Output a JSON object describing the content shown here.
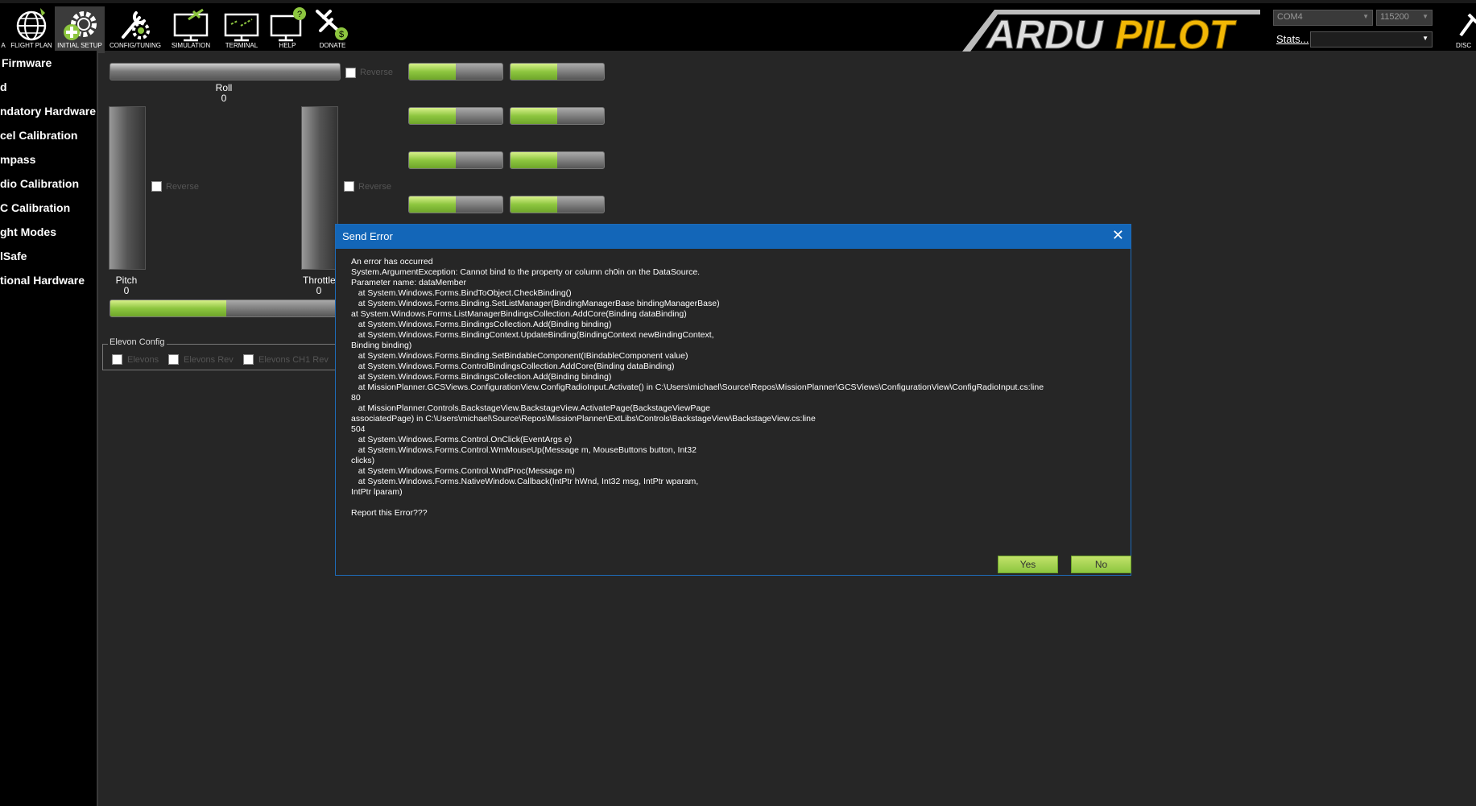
{
  "toolbar": {
    "items": [
      {
        "label": "A",
        "icon": "data-icon"
      },
      {
        "label": "FLIGHT PLAN",
        "icon": "globe-icon"
      },
      {
        "label": "INITIAL SETUP",
        "icon": "gear-plus-icon"
      },
      {
        "label": "CONFIG/TUNING",
        "icon": "wrench-gear-icon"
      },
      {
        "label": "SIMULATION",
        "icon": "monitor-plane-icon"
      },
      {
        "label": "TERMINAL",
        "icon": "terminal-monitor-icon"
      },
      {
        "label": "HELP",
        "icon": "help-monitor-icon"
      },
      {
        "label": "DONATE",
        "icon": "plane-dollar-icon"
      }
    ],
    "logo_text": "ARDUPILOT",
    "port": "COM4",
    "baud": "115200",
    "stats_label": "Stats...",
    "connect_label": "DISC"
  },
  "sidebar": {
    "items": [
      "Firmware",
      "d",
      "ndatory Hardware",
      "cel Calibration",
      "mpass",
      "dio Calibration",
      "C Calibration",
      "ght Modes",
      "lSafe",
      "tional Hardware"
    ]
  },
  "radio": {
    "roll_label": "Roll",
    "roll_value": "0",
    "pitch_label": "Pitch",
    "pitch_value": "0",
    "throttle_label": "Throttle",
    "throttle_value": "0",
    "reverse_label": "Reverse",
    "channel_fill": 0.5,
    "bottom_bar_fill": 0.5,
    "elevon_config_title": "Elevon Config",
    "elevons_label": "Elevons",
    "elevons_rev_label": "Elevons Rev",
    "elevons_ch1_rev_label": "Elevons CH1 Rev"
  },
  "dialog": {
    "title": "Send Error",
    "message": "An error has occurred\nSystem.ArgumentException: Cannot bind to the property or column ch0in on the DataSource.\nParameter name: dataMember\n   at System.Windows.Forms.BindToObject.CheckBinding()\n   at System.Windows.Forms.Binding.SetListManager(BindingManagerBase bindingManagerBase)\nat System.Windows.Forms.ListManagerBindingsCollection.AddCore(Binding dataBinding)\n   at System.Windows.Forms.BindingsCollection.Add(Binding binding)\n   at System.Windows.Forms.BindingContext.UpdateBinding(BindingContext newBindingContext,\nBinding binding)\n   at System.Windows.Forms.Binding.SetBindableComponent(IBindableComponent value)\n   at System.Windows.Forms.ControlBindingsCollection.AddCore(Binding dataBinding)\n   at System.Windows.Forms.BindingsCollection.Add(Binding binding)\n   at MissionPlanner.GCSViews.ConfigurationView.ConfigRadioInput.Activate() in C:\\Users\\michael\\Source\\Repos\\MissionPlanner\\GCSViews\\ConfigurationView\\ConfigRadioInput.cs:line\n80\n   at MissionPlanner.Controls.BackstageView.BackstageView.ActivatePage(BackstageViewPage\nassociatedPage) in C:\\Users\\michael\\Source\\Repos\\MissionPlanner\\ExtLibs\\Controls\\BackstageView\\BackstageView.cs:line\n504\n   at System.Windows.Forms.Control.OnClick(EventArgs e)\n   at System.Windows.Forms.Control.WmMouseUp(Message m, MouseButtons button, Int32\nclicks)\n   at System.Windows.Forms.Control.WndProc(Message m)\n   at System.Windows.Forms.NativeWindow.Callback(IntPtr hWnd, Int32 msg, IntPtr wparam,\nIntPtr lparam)\n\nReport this Error???",
    "yes_label": "Yes",
    "no_label": "No"
  },
  "colors": {
    "accent_green": "#8dc63f",
    "dialog_title_blue": "#1366b8",
    "logo_yellow": "#f2b705"
  }
}
